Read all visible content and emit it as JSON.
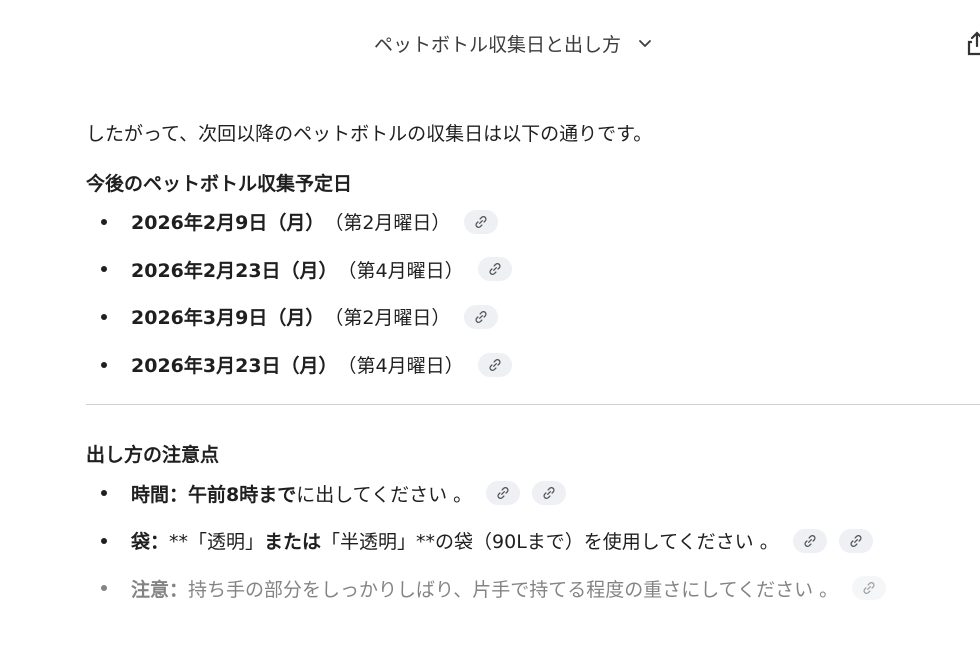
{
  "header": {
    "title": "ペットボトル収集日と出し方",
    "chevron_icon": "chevron-down-icon",
    "right_icon": "share-icon"
  },
  "content": {
    "intro": "したがって、次回以降のペットボトルの収集日は以下の通りです。",
    "schedule": {
      "heading": "今後のペットボトル収集予定日",
      "items": [
        {
          "date": "2026年2月9日（月）",
          "note": "（第2月曜日）"
        },
        {
          "date": "2026年2月23日（月）",
          "note": "（第4月曜日）"
        },
        {
          "date": "2026年3月9日（月）",
          "note": "（第2月曜日）"
        },
        {
          "date": "2026年3月23日（月）",
          "note": "（第4月曜日）"
        }
      ]
    },
    "tips": {
      "heading": "出し方の注意点",
      "items": [
        {
          "label": "時間：",
          "bold": "午前8時まで",
          "text": "に出してください 。"
        },
        {
          "label": "袋：",
          "text1": "**「透明」",
          "bold": "または",
          "text2": "「半透明」**の袋（90Lまで）を使用してください 。"
        },
        {
          "label": "注意：",
          "text": "持ち手の部分をしっかりしばり、片手で持てる程度の重さにしてください 。"
        }
      ]
    }
  },
  "colors": {
    "text": "#1f1f1f",
    "muted": "#3c3c3c",
    "chip_bg": "#eef0f4",
    "divider": "#d0d0d0"
  }
}
